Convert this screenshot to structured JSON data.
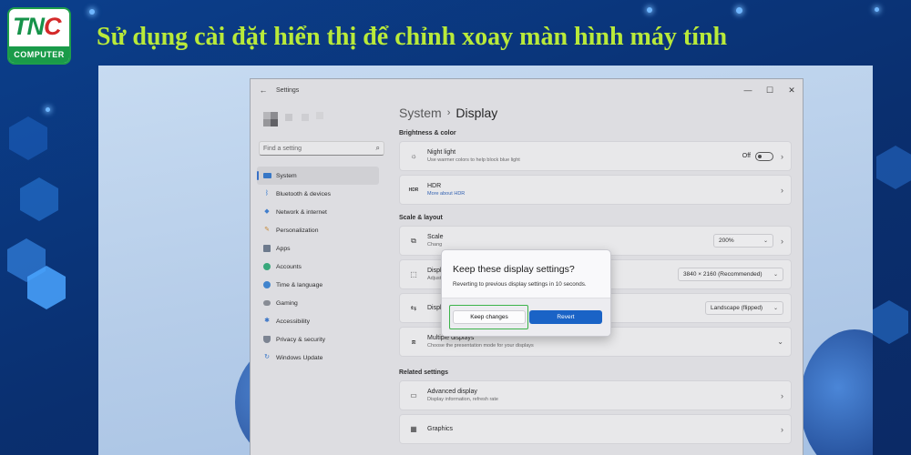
{
  "banner": {
    "title": "Sử dụng cài đặt hiển thị để chỉnh xoay màn hình máy tính",
    "logo_top_a": "TN",
    "logo_top_b": "C",
    "logo_bottom": "COMPUTER",
    "title_color": "#b9ea3a",
    "brand_green": "#1a9b49"
  },
  "window": {
    "back_icon": "back-arrow-icon",
    "title": "Settings",
    "controls": {
      "minimize": "—",
      "maximize": "☐",
      "close": "✕"
    }
  },
  "sidebar": {
    "search_placeholder": "Find a setting",
    "search_icon": "search-icon",
    "items": [
      {
        "label": "System",
        "icon": "monitor-icon",
        "active": true
      },
      {
        "label": "Bluetooth & devices",
        "icon": "bluetooth-icon"
      },
      {
        "label": "Network & internet",
        "icon": "wifi-icon"
      },
      {
        "label": "Personalization",
        "icon": "brush-icon"
      },
      {
        "label": "Apps",
        "icon": "apps-icon"
      },
      {
        "label": "Accounts",
        "icon": "person-icon"
      },
      {
        "label": "Time & language",
        "icon": "globe-clock-icon"
      },
      {
        "label": "Gaming",
        "icon": "gamepad-icon"
      },
      {
        "label": "Accessibility",
        "icon": "accessibility-icon"
      },
      {
        "label": "Privacy & security",
        "icon": "shield-icon"
      },
      {
        "label": "Windows Update",
        "icon": "update-icon"
      }
    ]
  },
  "main": {
    "breadcrumb_parent": "System",
    "breadcrumb_sep": "›",
    "breadcrumb_current": "Display",
    "section_brightness": "Brightness & color",
    "night_light_title": "Night light",
    "night_light_desc": "Use warmer colors to help block blue light",
    "night_light_state": "Off",
    "hdr_title": "HDR",
    "hdr_link": "More about HDR",
    "section_scale": "Scale & layout",
    "scale_title": "Scale",
    "scale_desc": "Chang",
    "scale_value": "200%",
    "resolution_title": "Displ",
    "resolution_desc": "Adjust",
    "resolution_value": "3840 × 2160 (Recommended)",
    "orientation_title": "Displ",
    "orientation_value": "Landscape (flipped)",
    "multiple_title": "Multiple displays",
    "multiple_desc": "Choose the presentation mode for your displays",
    "section_related": "Related settings",
    "advanced_title": "Advanced display",
    "advanced_desc": "Display information, refresh rate",
    "graphics_title": "Graphics"
  },
  "dialog": {
    "title": "Keep these display settings?",
    "message": "Reverting to previous display settings in 10 seconds.",
    "keep_label": "Keep changes",
    "revert_label": "Revert",
    "accent": "#1a63c6",
    "highlight_color": "#3cb34a"
  }
}
